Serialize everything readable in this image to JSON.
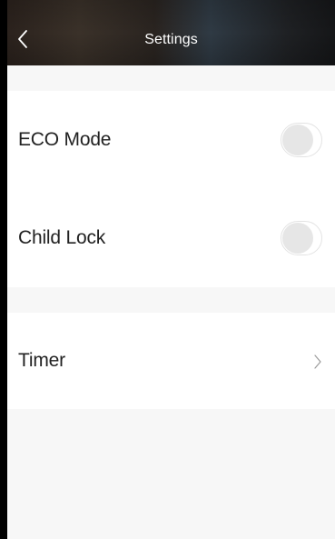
{
  "header": {
    "title": "Settings",
    "back_icon": "chevron-left-icon"
  },
  "settings": {
    "eco_mode": {
      "label": "ECO Mode",
      "enabled": false
    },
    "child_lock": {
      "label": "Child Lock",
      "enabled": false
    },
    "timer": {
      "label": "Timer",
      "icon": "chevron-right-icon"
    }
  },
  "colors": {
    "background": "#f8f8f8",
    "row_background": "#ffffff",
    "toggle_off": "#e6e6e6",
    "text": "#222222",
    "header_text": "#ffffff"
  }
}
